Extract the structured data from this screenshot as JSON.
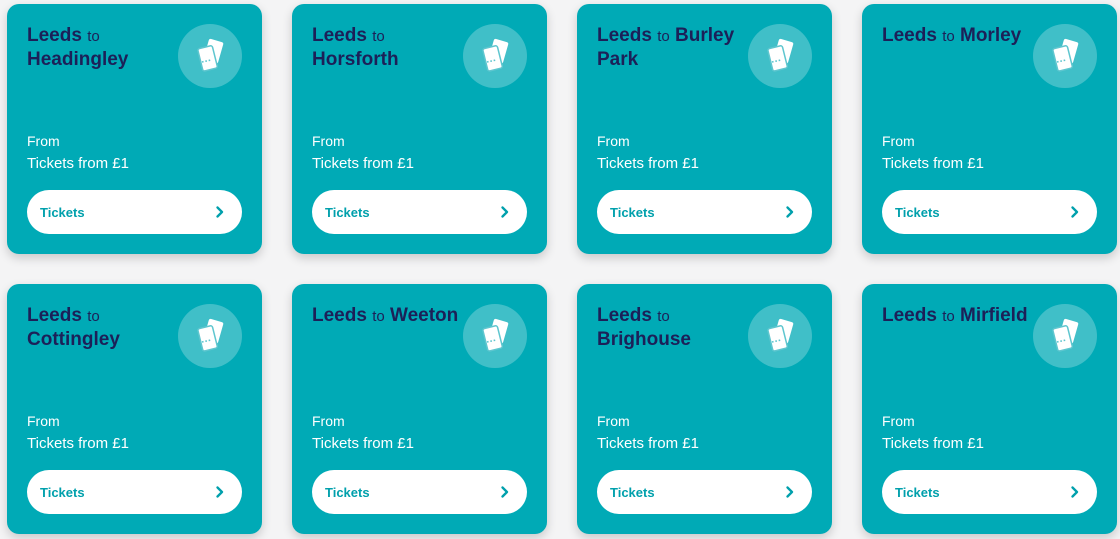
{
  "routes": [
    {
      "origin": "Leeds",
      "connector": "to",
      "destination": "Headingley",
      "from_label": "From",
      "price_text": "Tickets from £1",
      "button_label": "Tickets"
    },
    {
      "origin": "Leeds",
      "connector": "to",
      "destination": "Horsforth",
      "from_label": "From",
      "price_text": "Tickets from £1",
      "button_label": "Tickets"
    },
    {
      "origin": "Leeds",
      "connector": "to",
      "destination": "Burley Park",
      "from_label": "From",
      "price_text": "Tickets from £1",
      "button_label": "Tickets"
    },
    {
      "origin": "Leeds",
      "connector": "to",
      "destination": "Morley",
      "from_label": "From",
      "price_text": "Tickets from £1",
      "button_label": "Tickets"
    },
    {
      "origin": "Leeds",
      "connector": "to",
      "destination": "Cottingley",
      "from_label": "From",
      "price_text": "Tickets from £1",
      "button_label": "Tickets"
    },
    {
      "origin": "Leeds",
      "connector": "to",
      "destination": "Weeton",
      "from_label": "From",
      "price_text": "Tickets from £1",
      "button_label": "Tickets"
    },
    {
      "origin": "Leeds",
      "connector": "to",
      "destination": "Brighouse",
      "from_label": "From",
      "price_text": "Tickets from £1",
      "button_label": "Tickets"
    },
    {
      "origin": "Leeds",
      "connector": "to",
      "destination": "Mirfield",
      "from_label": "From",
      "price_text": "Tickets from £1",
      "button_label": "Tickets"
    }
  ],
  "icons": {
    "card_icon": "ticket-icon",
    "button_icon": "chevron-right-icon"
  },
  "colors": {
    "card_background": "#00aab6",
    "title_text": "#1c2058",
    "button_text": "#00a0ac",
    "page_background": "#f4f4f5"
  }
}
